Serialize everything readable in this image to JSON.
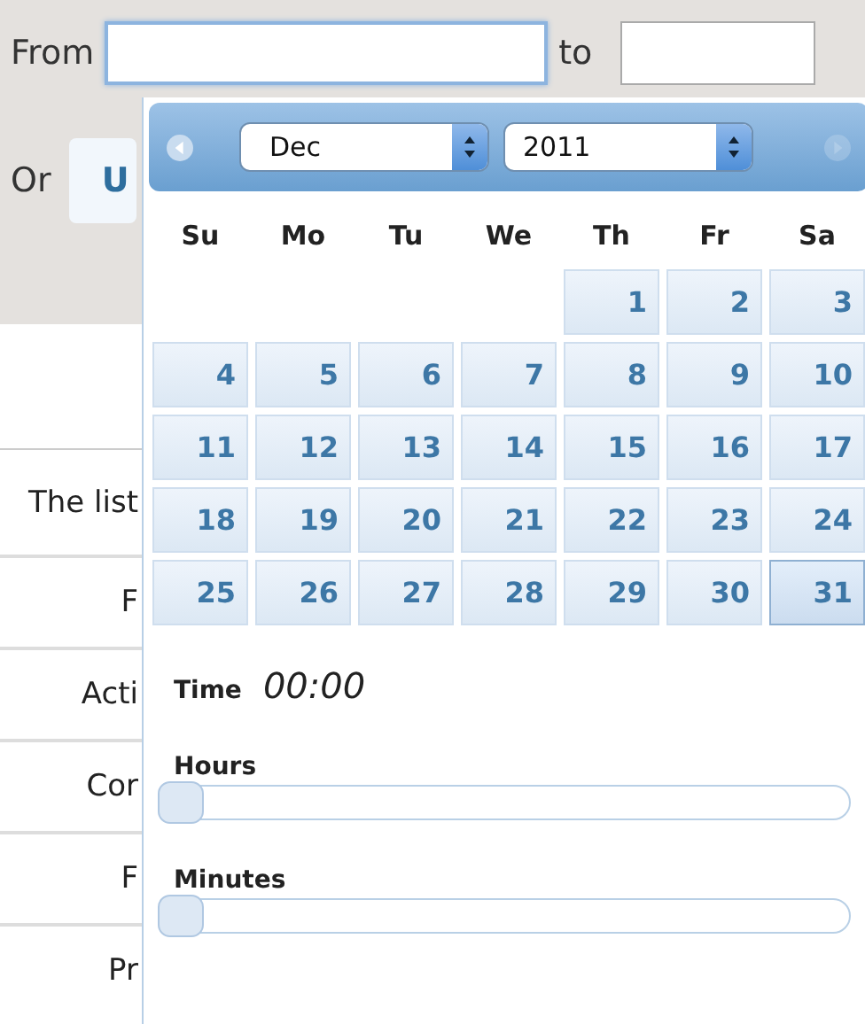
{
  "filter": {
    "from_label": "From",
    "to_label": "to",
    "or_label": "Or",
    "button_label": "U"
  },
  "side_labels": [
    "The list",
    "F",
    "Acti",
    "Cor",
    "F",
    "Pr"
  ],
  "datepicker": {
    "prev_disabled": false,
    "next_disabled": true,
    "month": "Dec",
    "year": "2011",
    "weekdays": [
      "Su",
      "Mo",
      "Tu",
      "We",
      "Th",
      "Fr",
      "Sa"
    ],
    "weeks": [
      [
        {
          "kind": "blank"
        },
        {
          "kind": "blank"
        },
        {
          "kind": "blank"
        },
        {
          "kind": "blank"
        },
        {
          "day": "1",
          "selected": false
        },
        {
          "day": "2",
          "selected": false
        },
        {
          "day": "3",
          "selected": false
        }
      ],
      [
        {
          "day": "4",
          "selected": false
        },
        {
          "day": "5",
          "selected": false
        },
        {
          "day": "6",
          "selected": false
        },
        {
          "day": "7",
          "selected": false
        },
        {
          "day": "8",
          "selected": false
        },
        {
          "day": "9",
          "selected": false
        },
        {
          "day": "10",
          "selected": false
        }
      ],
      [
        {
          "day": "11",
          "selected": false
        },
        {
          "day": "12",
          "selected": false
        },
        {
          "day": "13",
          "selected": false
        },
        {
          "day": "14",
          "selected": false
        },
        {
          "day": "15",
          "selected": false
        },
        {
          "day": "16",
          "selected": false
        },
        {
          "day": "17",
          "selected": false
        }
      ],
      [
        {
          "day": "18",
          "selected": false
        },
        {
          "day": "19",
          "selected": false
        },
        {
          "day": "20",
          "selected": false
        },
        {
          "day": "21",
          "selected": false
        },
        {
          "day": "22",
          "selected": false
        },
        {
          "day": "23",
          "selected": false
        },
        {
          "day": "24",
          "selected": false
        }
      ],
      [
        {
          "day": "25",
          "selected": false
        },
        {
          "day": "26",
          "selected": false
        },
        {
          "day": "27",
          "selected": false
        },
        {
          "day": "28",
          "selected": false
        },
        {
          "day": "29",
          "selected": false
        },
        {
          "day": "30",
          "selected": false
        },
        {
          "day": "31",
          "selected": true
        }
      ]
    ],
    "time_label": "Time",
    "time_value": "00:00",
    "sliders": [
      {
        "label": "Hours",
        "level": 0
      },
      {
        "label": "Minutes",
        "level": 0
      }
    ]
  }
}
